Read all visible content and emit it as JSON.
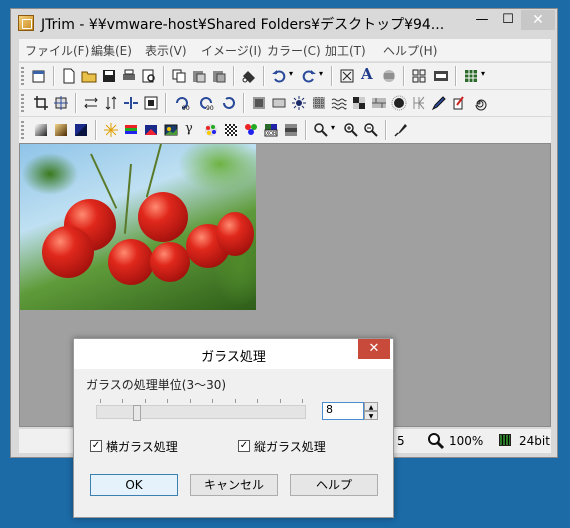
{
  "window": {
    "title": "JTrim - ¥¥vmware-host¥Shared Folders¥デスクトップ¥94...",
    "minimize": "—",
    "maximize": "☐",
    "close": "✕"
  },
  "menu": [
    "ファイル(F)",
    "編集(E)",
    "表示(V)",
    "イメージ(I)",
    "カラー(C)",
    "加工(T)",
    "ヘルプ(H)"
  ],
  "toolbar": {
    "row1_icons": [
      "new-window-icon",
      "new-file-icon",
      "open-icon",
      "save-icon",
      "print-icon",
      "print-preview-icon",
      "copy-icon",
      "paste-icon",
      "paste-new-icon",
      "trim-paste-icon",
      "undo-icon",
      "redo-icon",
      "fit-icon",
      "text-icon",
      "align-icon",
      "grid-icon",
      "film-icon",
      "tiles-icon"
    ],
    "row2_icons": [
      "crop-icon",
      "resize-icon",
      "flip-h-icon",
      "flip-v-icon",
      "mirror-icon",
      "frame-icon",
      "rotate-left-90-icon",
      "rotate-right-90-icon",
      "rotate-icon",
      "emboss-icon",
      "button-icon",
      "sunburst-icon",
      "mosaic-icon",
      "wave-icon",
      "relief-icon",
      "brick-icon",
      "blur-icon",
      "sharpen-icon",
      "pen-icon",
      "brush-icon",
      "spiral-icon"
    ],
    "row3_icons": [
      "gradient-icon",
      "sepia-icon",
      "color-icon",
      "sparkle-icon",
      "rgb-icon",
      "hue-icon",
      "picture-icon",
      "gamma-icon",
      "palette-icon",
      "dither-icon",
      "colorize-icon",
      "xor-icon",
      "grayscale-icon",
      "zoom-menu-icon",
      "zoom-in-icon",
      "zoom-out-icon",
      "eyedropper-icon"
    ]
  },
  "status": {
    "num": "5",
    "zoom": "100%",
    "depth": "24bit"
  },
  "dialog": {
    "title": "ガラス処理",
    "close": "✕",
    "label": "ガラスの処理単位(3〜30)",
    "slider_value": 8,
    "slider_min": 3,
    "slider_max": 30,
    "spin_value": "8",
    "check_h_label": "横ガラス処理",
    "check_h_checked": true,
    "check_v_label": "縦ガラス処理",
    "check_v_checked": true,
    "ok": "OK",
    "cancel": "キャンセル",
    "help": "ヘルプ"
  },
  "colors": {
    "desktop": "#1c6aa6",
    "canvas": "#a0a0a0",
    "dialog_close": "#c74a3a"
  }
}
